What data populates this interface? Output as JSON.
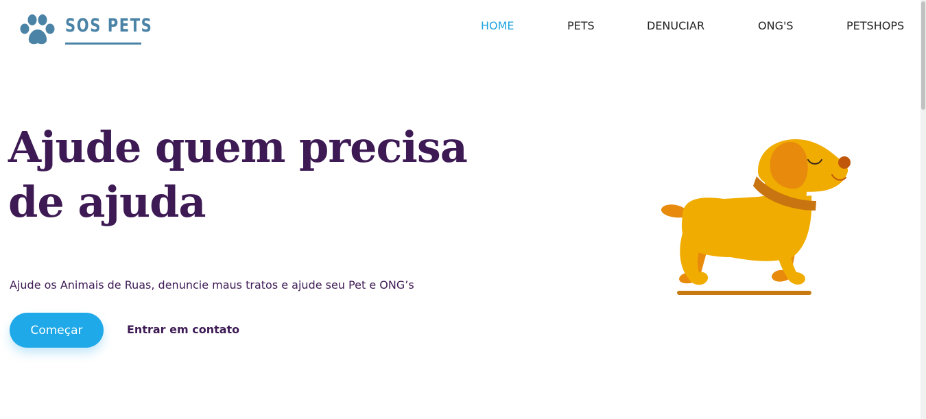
{
  "header": {
    "logo_text": "SOS PETS",
    "nav": [
      {
        "label": "HOME",
        "active": true
      },
      {
        "label": "PETS",
        "active": false
      },
      {
        "label": "DENUCIAR",
        "active": false
      },
      {
        "label": "ONG'S",
        "active": false
      },
      {
        "label": "PETSHOPS",
        "active": false
      }
    ]
  },
  "hero": {
    "title_line1": "Ajude quem precisa",
    "title_line2": "de ajuda",
    "subtitle": "Ajude os Animais de Ruas, denuncie maus tratos e ajude seu Pet e ONG’s",
    "primary_button": "Começar",
    "secondary_link": "Entrar em contato"
  },
  "illustration": "dog-illustration",
  "colors": {
    "brand": "#4a83a6",
    "accent": "#1fa9e8",
    "nav_active": "#1fa3e0",
    "heading": "#3d1a54",
    "dog_body": "#f0ac00",
    "dog_dark": "#d27a0c"
  }
}
